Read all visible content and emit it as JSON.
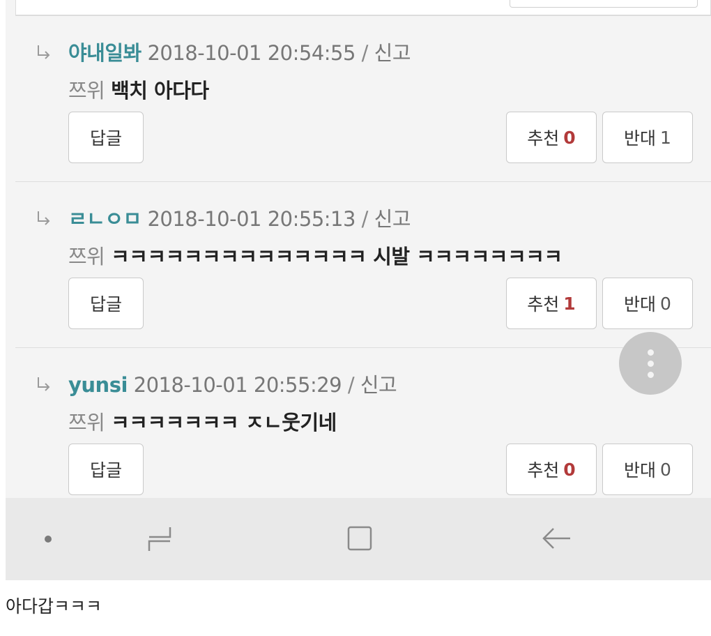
{
  "comments": [
    {
      "author": "야내일봐",
      "timestamp": "2018-10-01 20:54:55",
      "separator": "/",
      "report_label": "신고",
      "to_label": "쯔위",
      "message": "백치 아다다",
      "reply_label": "답글",
      "upvote_label": "추천",
      "upvote_count": "0",
      "downvote_label": "반대",
      "downvote_count": "1"
    },
    {
      "author": "ㄹㄴㅇㅁ",
      "timestamp": "2018-10-01 20:55:13",
      "separator": "/",
      "report_label": "신고",
      "to_label": "쯔위",
      "message": "ㅋㅋㅋㅋㅋㅋㅋㅋㅋㅋㅋㅋㅋㅋ 시발 ㅋㅋㅋㅋㅋㅋㅋㅋ",
      "reply_label": "답글",
      "upvote_label": "추천",
      "upvote_count": "1",
      "downvote_label": "반대",
      "downvote_count": "0"
    },
    {
      "author": "yunsi",
      "timestamp": "2018-10-01 20:55:29",
      "separator": "/",
      "report_label": "신고",
      "to_label": "쯔위",
      "message": "ㅋㅋㅋㅋㅋㅋㅋ ㅈㄴ웃기네",
      "reply_label": "답글",
      "upvote_label": "추천",
      "upvote_count": "0",
      "downvote_label": "반대",
      "downvote_count": "0"
    }
  ],
  "icons": {
    "reply_indicator": "reply-arrow-icon",
    "fab": "more-vertical-icon",
    "nav_recent": "recent-apps-icon",
    "nav_home": "home-icon",
    "nav_back": "back-icon"
  },
  "colors": {
    "author": "#3a8d96",
    "upvote_count": "#b23a3a",
    "background": "#f4f4f4",
    "navbar": "#e9e9e9"
  },
  "caption": "아다갑ㅋㅋㅋ"
}
